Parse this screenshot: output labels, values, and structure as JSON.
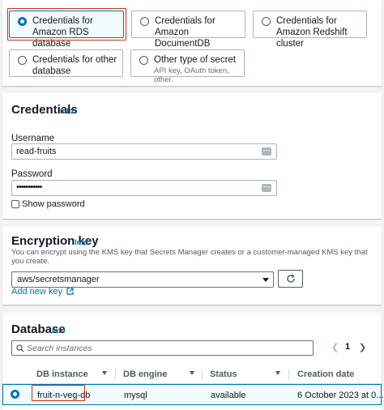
{
  "secret_types": {
    "rds": "Credentials for Amazon RDS database",
    "documentdb": "Credentials for Amazon DocumentDB database",
    "redshift": "Credentials for Amazon Redshift cluster",
    "other_db": "Credentials for other database",
    "other_secret": "Other type of secret",
    "other_secret_desc": "API key, OAuth token, other."
  },
  "credentials": {
    "title": "Credentials",
    "info": "Info",
    "username_label": "Username",
    "username_value": "read-fruits",
    "password_label": "Password",
    "password_value": "•••••••••••",
    "show_password": "Show password"
  },
  "encryption": {
    "title": "Encryption key",
    "info": "Info",
    "description": "You can encrypt using the KMS key that Secrets Manager creates or a customer-managed KMS key that you create.",
    "selected_key": "aws/secretsmanager",
    "add_new_key": "Add new key"
  },
  "database": {
    "title": "Database",
    "info": "Info",
    "search_placeholder": "Search instances",
    "page": "1",
    "columns": [
      "DB instance",
      "DB engine",
      "Status",
      "Creation date"
    ],
    "rows": [
      {
        "instance": "fruit-n-veg-db",
        "engine": "mysql",
        "status": "available",
        "created": "6 October 2023 at 0..."
      }
    ]
  },
  "colors": {
    "accent": "#0073bb",
    "highlight": "#d13212",
    "selected_bg": "#f1faff"
  }
}
